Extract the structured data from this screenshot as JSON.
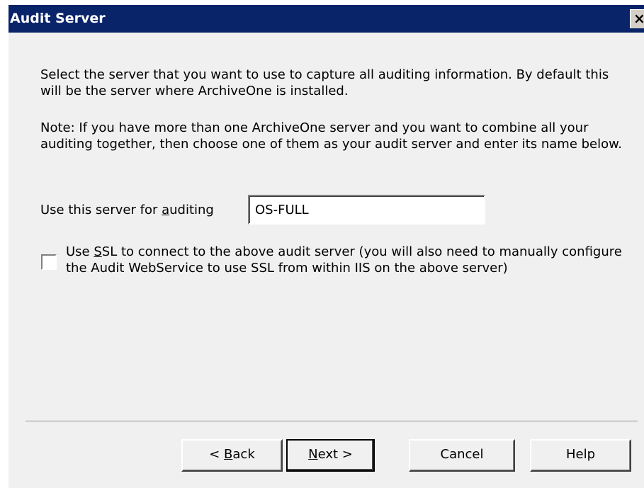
{
  "window": {
    "title": "Audit Server",
    "close_glyph": "×"
  },
  "content": {
    "paragraph1": "Select the server that you want to use to capture all auditing information. By default this will be the server where ArchiveOne is installed.",
    "paragraph2": "Note: If you have more than one ArchiveOne server and you want to combine all your auditing together, then choose one of them as your audit server and enter its name below.",
    "server_label_pre": "Use this server for ",
    "server_label_accel": "a",
    "server_label_post": "uditing",
    "server_value": "OS-FULL",
    "ssl_checked": false,
    "ssl_label_pre": "Use ",
    "ssl_label_accel": "S",
    "ssl_label_post": "SL to connect to the above audit server (you will also need to manually configure the Audit WebService to use SSL from within IIS on the above server)"
  },
  "buttons": {
    "back_pre": "< ",
    "back_accel": "B",
    "back_post": "ack",
    "next_accel": "N",
    "next_post": "ext >",
    "cancel": "Cancel",
    "help": "Help"
  },
  "colors": {
    "titlebar": "#0a246a",
    "dialog_bg": "#f0f0f0"
  }
}
